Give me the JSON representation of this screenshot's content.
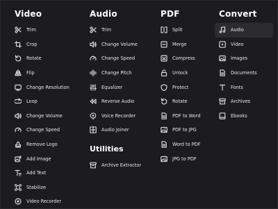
{
  "columns": {
    "video": {
      "heading": "Video",
      "items": [
        {
          "label": "Trim",
          "icon": "scissors-icon"
        },
        {
          "label": "Crop",
          "icon": "crop-icon"
        },
        {
          "label": "Rotate",
          "icon": "rotate-icon"
        },
        {
          "label": "Flip",
          "icon": "flip-icon"
        },
        {
          "label": "Change Resolution",
          "icon": "resolution-icon"
        },
        {
          "label": "Loop",
          "icon": "loop-icon"
        },
        {
          "label": "Change Volume",
          "icon": "volume-icon"
        },
        {
          "label": "Change Speed",
          "icon": "speed-icon"
        },
        {
          "label": "Remove Logo",
          "icon": "stamp-icon"
        },
        {
          "label": "Add Image",
          "icon": "add-image-icon"
        },
        {
          "label": "Add Text",
          "icon": "text-icon"
        },
        {
          "label": "Stabilize",
          "icon": "stabilize-icon"
        },
        {
          "label": "Video Recorder",
          "icon": "record-icon"
        }
      ]
    },
    "audio": {
      "heading": "Audio",
      "items": [
        {
          "label": "Trim",
          "icon": "scissors-icon"
        },
        {
          "label": "Change Volume",
          "icon": "volume-icon"
        },
        {
          "label": "Change Speed",
          "icon": "speed-icon"
        },
        {
          "label": "Change Pitch",
          "icon": "pitch-icon"
        },
        {
          "label": "Equalizer",
          "icon": "equalizer-icon"
        },
        {
          "label": "Reverse Audio",
          "icon": "reverse-icon"
        },
        {
          "label": "Voice Recorder",
          "icon": "microphone-icon"
        },
        {
          "label": "Audio Joiner",
          "icon": "joiner-icon"
        }
      ],
      "utilities_heading": "Utilities",
      "utilities": [
        {
          "label": "Archive Extractor",
          "icon": "archive-icon"
        }
      ]
    },
    "pdf": {
      "heading": "PDF",
      "items": [
        {
          "label": "Split",
          "icon": "split-icon"
        },
        {
          "label": "Merge",
          "icon": "merge-icon"
        },
        {
          "label": "Compress",
          "icon": "compress-icon"
        },
        {
          "label": "Unlock",
          "icon": "unlock-icon"
        },
        {
          "label": "Protect",
          "icon": "shield-icon"
        },
        {
          "label": "Rotate",
          "icon": "rotate-icon"
        },
        {
          "label": "PDF to Word",
          "icon": "document-icon"
        },
        {
          "label": "PDF to JPG",
          "icon": "image-icon"
        },
        {
          "label": "Word to PDF",
          "icon": "document-icon"
        },
        {
          "label": "JPG to PDF",
          "icon": "image-icon"
        }
      ]
    },
    "convert": {
      "heading": "Convert",
      "items": [
        {
          "label": "Audio",
          "icon": "music-note-icon",
          "active": true
        },
        {
          "label": "Video",
          "icon": "video-file-icon"
        },
        {
          "label": "Images",
          "icon": "image-icon"
        },
        {
          "label": "Documents",
          "icon": "document-icon"
        },
        {
          "label": "Fonts",
          "icon": "font-icon"
        },
        {
          "label": "Archives",
          "icon": "archive-icon"
        },
        {
          "label": "Ebooks",
          "icon": "book-icon"
        }
      ]
    }
  },
  "colors": {
    "background": "#1c1c1e",
    "text": "#e8e8e8",
    "heading": "#ffffff",
    "active_bg": "#2c2c2e"
  }
}
